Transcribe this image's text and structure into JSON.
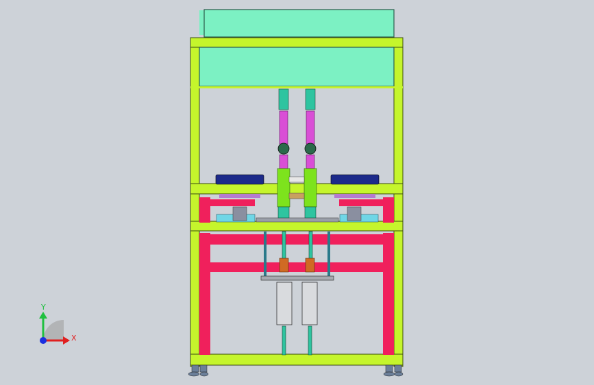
{
  "viewport": {
    "background": "#cdd2d8"
  },
  "machine": {
    "frame_color": "#c5f52c",
    "frame_outline": "#3a4a10",
    "cabinet_color": "#7cf1c3",
    "cabinet_outline": "#2b5b4a",
    "support_color": "#f0205c",
    "cylinder_color": "#d9dbde",
    "rod_color": "#2ec4a0",
    "magenta_tube": "#d94fd6",
    "green_tube": "#7de31d",
    "copper_ring": "#d06a24",
    "cyan_plate": "#6fd6e6",
    "motor_color": "#1c2a8a",
    "foot_color": "#6b7f99"
  },
  "triad": {
    "x_label": "X",
    "y_label": "Y",
    "x_color": "#e02020",
    "y_color": "#20c040",
    "z_color": "#1a2fe0"
  }
}
